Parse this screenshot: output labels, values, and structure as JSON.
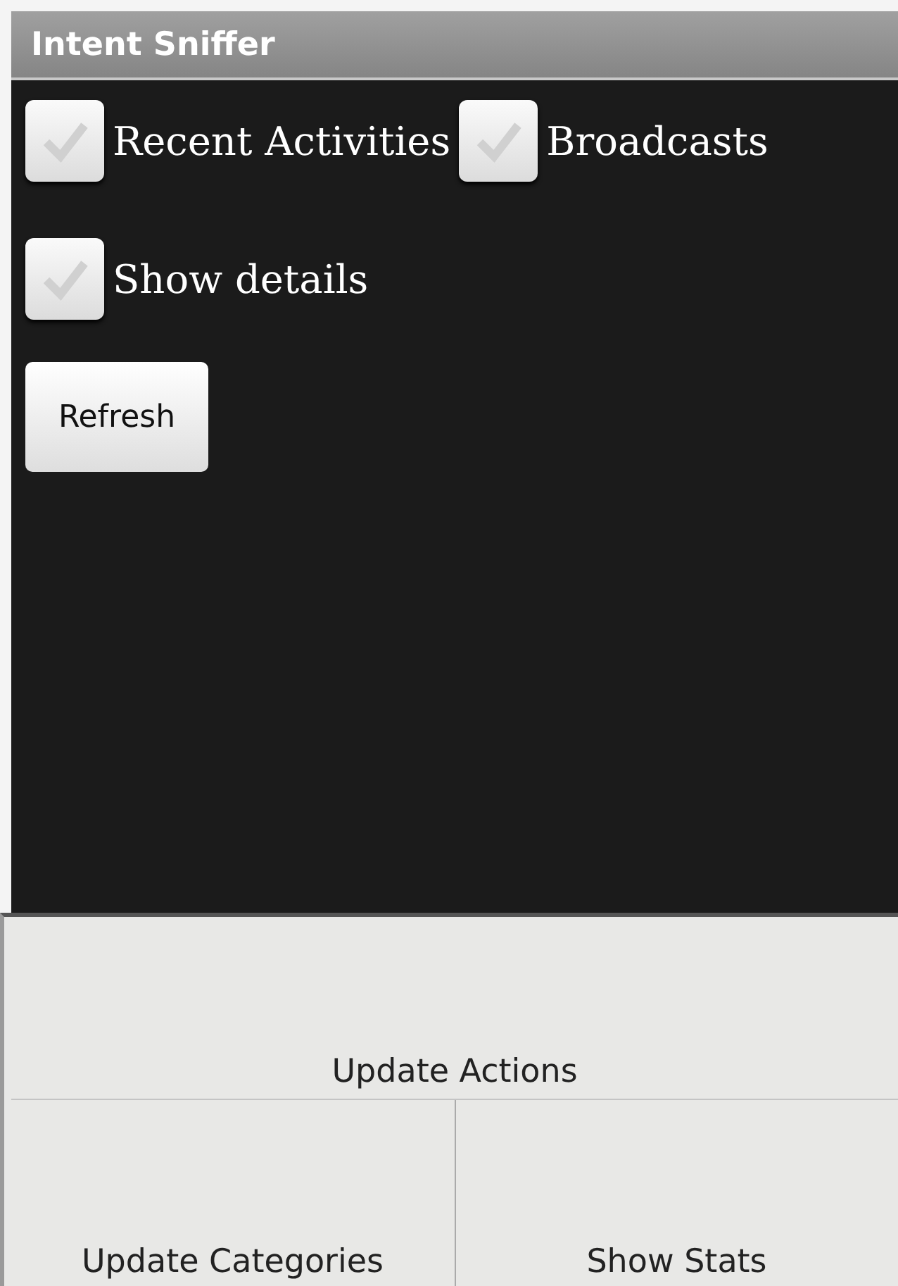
{
  "window": {
    "title": "Intent Sniffer"
  },
  "options": [
    {
      "label": "Recent Activities",
      "checked": false
    },
    {
      "label": "Broadcasts",
      "checked": false
    },
    {
      "label": "Show details",
      "checked": false
    }
  ],
  "refresh_button": "Refresh",
  "menu": [
    {
      "label": "Update Actions"
    },
    {
      "label": "Update Categories"
    },
    {
      "label": "Show Stats"
    }
  ]
}
